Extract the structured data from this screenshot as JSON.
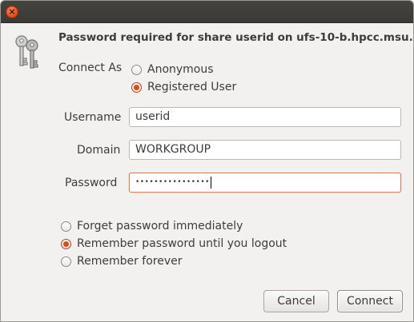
{
  "titlebar": {
    "close_glyph": "×"
  },
  "dialog": {
    "icon": "keys-icon",
    "heading": "Password required for share userid on ufs-10-b.hpcc.msu.edu",
    "connect_as": {
      "label": "Connect As",
      "options": [
        {
          "label": "Anonymous",
          "checked": false
        },
        {
          "label": "Registered User",
          "checked": true
        }
      ]
    },
    "fields": {
      "username": {
        "label": "Username",
        "value": "userid"
      },
      "domain": {
        "label": "Domain",
        "value": "WORKGROUP"
      },
      "password": {
        "label": "Password",
        "value": "••••••••••••••••"
      }
    },
    "remember": {
      "options": [
        {
          "label": "Forget password immediately",
          "checked": false
        },
        {
          "label": "Remember password until you logout",
          "checked": true
        },
        {
          "label": "Remember forever",
          "checked": false
        }
      ]
    },
    "buttons": {
      "cancel": "Cancel",
      "connect": "Connect"
    }
  },
  "colors": {
    "accent": "#df4b16",
    "titlebar": "#3c3b37",
    "background": "#f2f1f0"
  }
}
